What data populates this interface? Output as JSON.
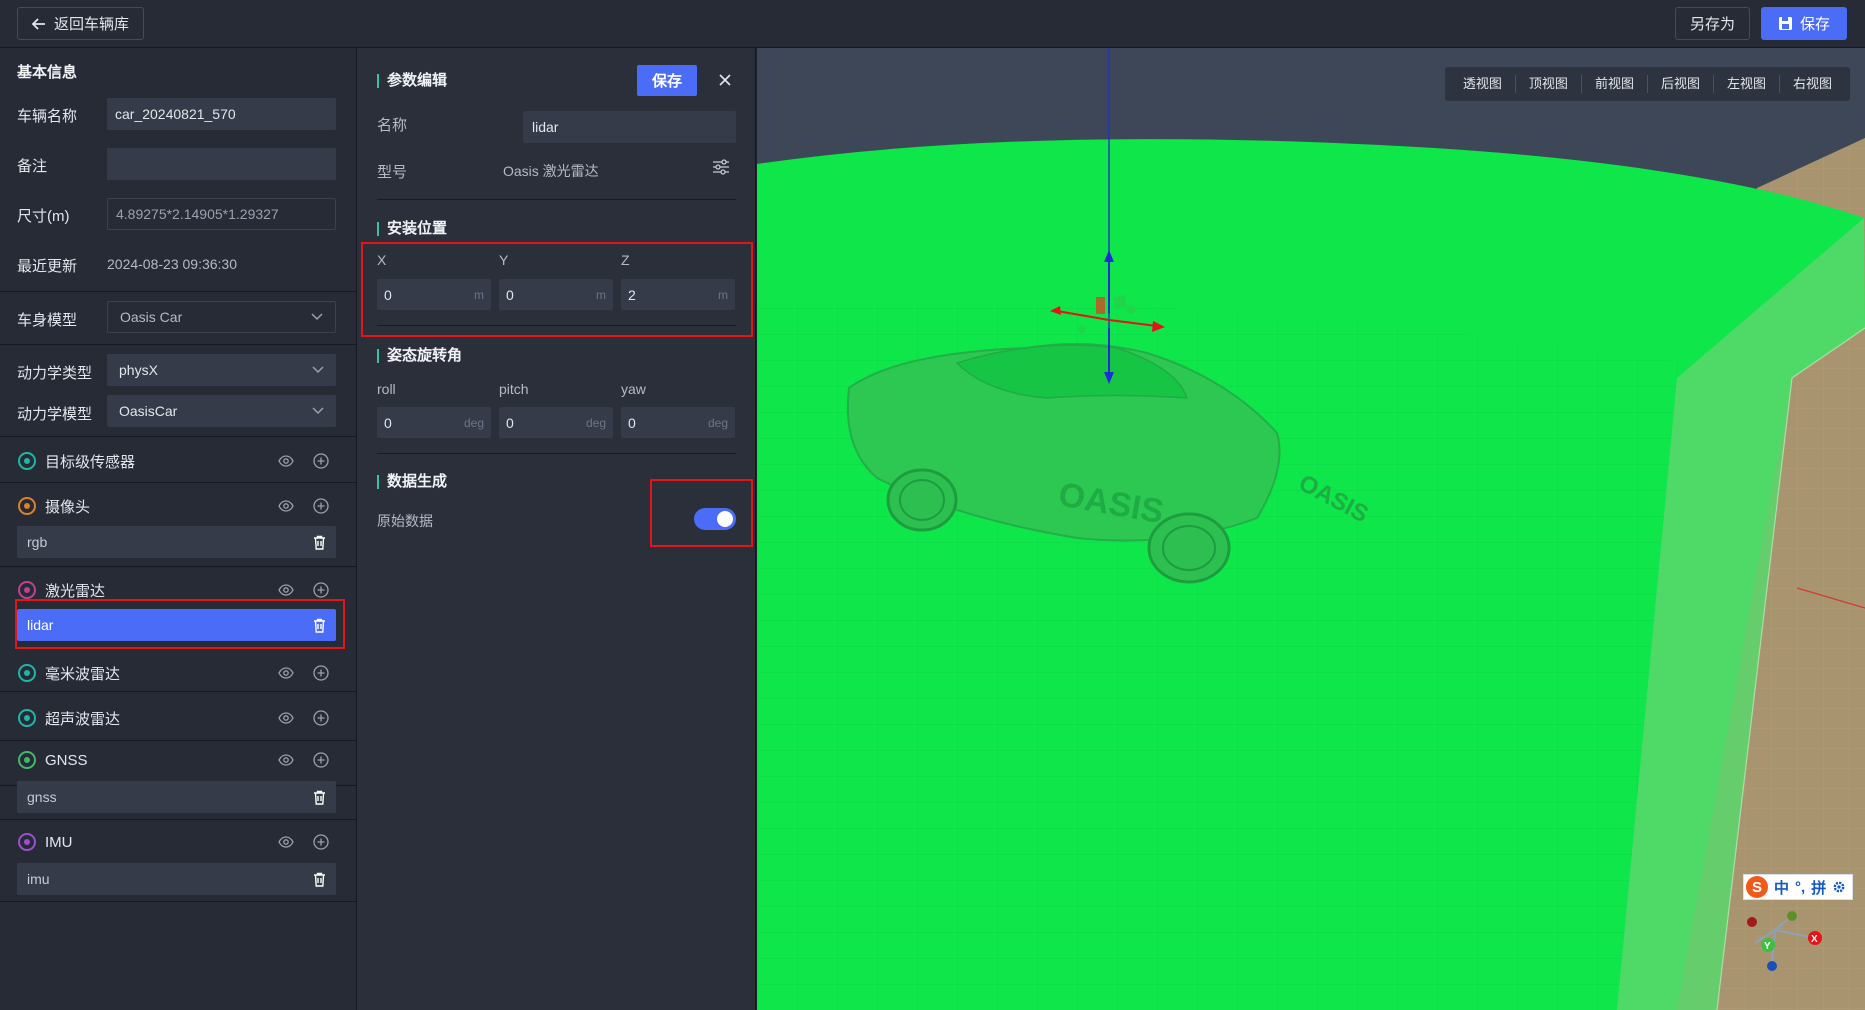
{
  "topbar": {
    "back_label": "返回车辆库",
    "save_as_label": "另存为",
    "save_label": "保存"
  },
  "basic_info": {
    "title": "基本信息",
    "vehicle_name_label": "车辆名称",
    "vehicle_name_value": "car_20240821_570",
    "note_label": "备注",
    "note_value": "",
    "size_label": "尺寸(m)",
    "size_value": "4.89275*2.14905*1.29327",
    "updated_label": "最近更新",
    "updated_value": "2024-08-23 09:36:30",
    "body_model_label": "车身模型",
    "body_model_value": "Oasis Car",
    "dynamics_type_label": "动力学类型",
    "dynamics_type_value": "physX",
    "dynamics_model_label": "动力学模型",
    "dynamics_model_value": "OasisCar"
  },
  "sensors": [
    {
      "label": "目标级传感器",
      "icon": "target-sensor-icon",
      "color": "#1fb6a8",
      "items": []
    },
    {
      "label": "摄像头",
      "icon": "camera-icon",
      "color": "#d9822b",
      "items": [
        "rgb"
      ]
    },
    {
      "label": "激光雷达",
      "icon": "lidar-icon",
      "color": "#c2408f",
      "items": [
        "lidar"
      ]
    },
    {
      "label": "毫米波雷达",
      "icon": "radar-icon",
      "color": "#1fb6a8",
      "items": []
    },
    {
      "label": "超声波雷达",
      "icon": "ultrasonic-icon",
      "color": "#1fb6a8",
      "items": []
    },
    {
      "label": "GNSS",
      "icon": "gnss-icon",
      "color": "#41b86b",
      "items": [
        "gnss"
      ]
    },
    {
      "label": "IMU",
      "icon": "imu-icon",
      "color": "#9b4fd1",
      "items": [
        "imu"
      ]
    }
  ],
  "param_editor": {
    "title": "参数编辑",
    "save_label": "保存",
    "name_label": "名称",
    "name_value": "lidar",
    "model_label": "型号",
    "model_value": "Oasis 激光雷达",
    "install_title": "安装位置",
    "x_label": "X",
    "x_value": "0",
    "x_unit": "m",
    "y_label": "Y",
    "y_value": "0",
    "y_unit": "m",
    "z_label": "Z",
    "z_value": "2",
    "z_unit": "m",
    "rotation_title": "姿态旋转角",
    "roll_label": "roll",
    "roll_value": "0",
    "roll_unit": "deg",
    "pitch_label": "pitch",
    "pitch_value": "0",
    "pitch_unit": "deg",
    "yaw_label": "yaw",
    "yaw_value": "0",
    "yaw_unit": "deg",
    "datagen_title": "数据生成",
    "raw_data_label": "原始数据",
    "raw_data_enabled": true
  },
  "viewport": {
    "views": [
      "透视图",
      "顶视图",
      "前视图",
      "后视图",
      "左视图",
      "右视图"
    ],
    "car_logo": "OASIS",
    "axis_x": "X",
    "axis_y": "Y",
    "ime": {
      "logo": "S",
      "lang": "中",
      "punct": "°,",
      "mode": "拼"
    }
  },
  "colors": {
    "accent": "#4a6cf7",
    "lidar_range": "#0ee64a",
    "highlight": "#e5131a",
    "section_bar": "#36c3a8"
  }
}
